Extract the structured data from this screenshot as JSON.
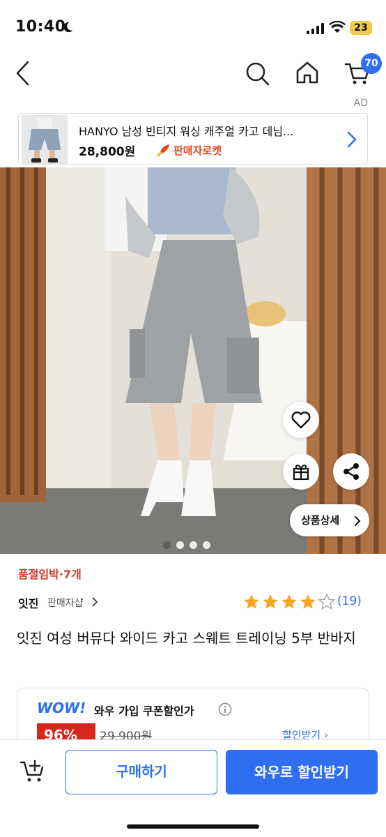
{
  "status_bar": {
    "time": "10:40",
    "battery": "23",
    "icons": [
      "moon-icon",
      "signal-icon",
      "wifi-icon",
      "battery-icon"
    ]
  },
  "nav": {
    "icons": [
      "back-icon",
      "search-icon",
      "home-icon",
      "cart-icon"
    ],
    "cart_count": "70",
    "ad_label": "AD"
  },
  "ad_card": {
    "title": "HANYO 남성 빈티지 워싱 캐주얼 카고 데님...",
    "price": "28,800원",
    "badge": "판매자로켓",
    "badge_color": "#e8441b"
  },
  "hero": {
    "detail_button": "상품상세",
    "image_count": 4,
    "active_index": 0,
    "icons": [
      "heart-icon",
      "gift-icon",
      "share-icon"
    ]
  },
  "product": {
    "stock_notice": "품절임박·7개",
    "seller": "잇진",
    "seller_link": "판매자샵",
    "rating": 4,
    "rating_max": 5,
    "reviews": "(19)",
    "title": "잇진 여성 버뮤다 와이드 카고 스웨트 트레이닝 5부 반바지"
  },
  "wow": {
    "logo": "WOW!",
    "label": "와우 가입 쿠폰할인가",
    "discount": "96%",
    "original_price": "29,900원",
    "coupon_link": "할인받기"
  },
  "bottom_bar": {
    "buy_label": "구매하기",
    "wow_label": "와우로 할인받기"
  },
  "colors": {
    "accent": "#2e6ff2",
    "alert": "#d33b2c",
    "star": "#f5a623"
  }
}
